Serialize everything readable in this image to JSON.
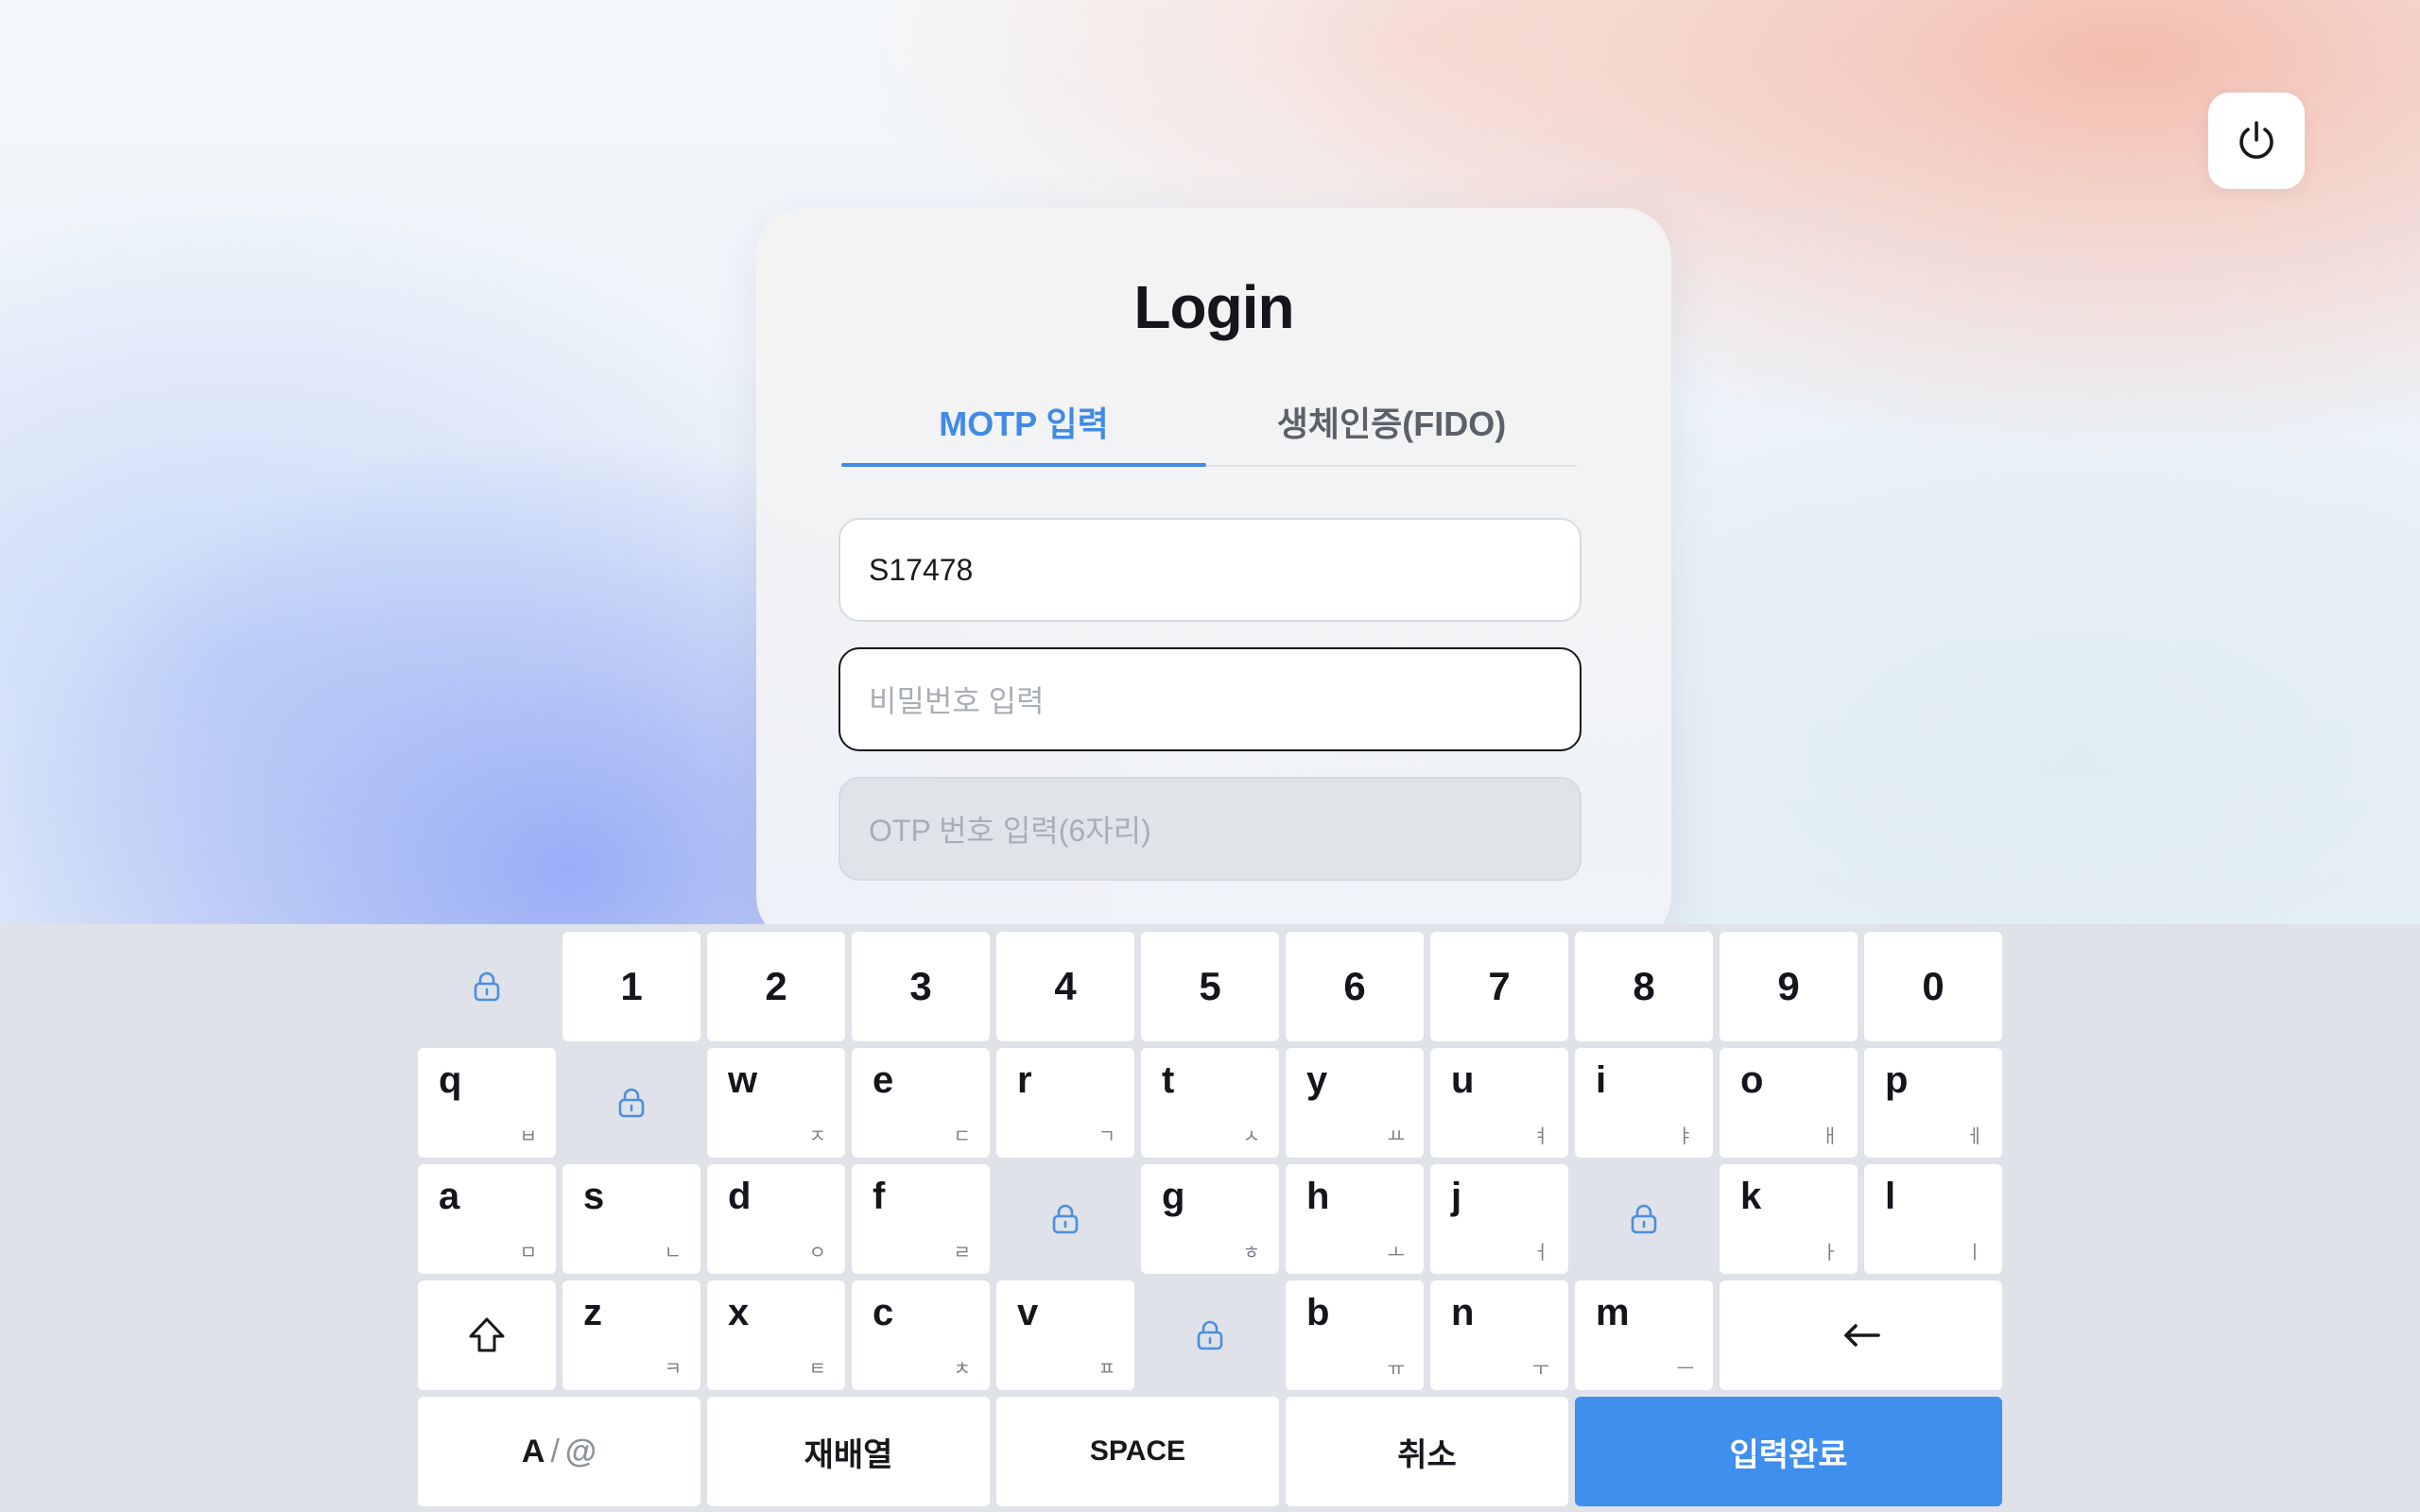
{
  "login": {
    "title": "Login",
    "tabs": [
      {
        "label": "MOTP 입력",
        "active": true
      },
      {
        "label": "생체인증(FIDO)",
        "active": false
      }
    ],
    "fields": {
      "user_id": {
        "value": "S17478"
      },
      "password": {
        "placeholder": "비밀번호 입력",
        "value": ""
      },
      "otp": {
        "placeholder": "OTP 번호 입력(6자리)",
        "value": "",
        "disabled": true
      }
    }
  },
  "power_button": {
    "icon": "power-icon"
  },
  "keyboard": {
    "row1": [
      "1",
      "2",
      "3",
      "4",
      "5",
      "6",
      "7",
      "8",
      "9",
      "0"
    ],
    "row2": [
      {
        "key": "q",
        "sub": "ㅂ"
      },
      {
        "key": "w",
        "sub": "ㅈ"
      },
      {
        "key": "e",
        "sub": "ㄷ"
      },
      {
        "key": "r",
        "sub": "ㄱ"
      },
      {
        "key": "t",
        "sub": "ㅅ"
      },
      {
        "key": "y",
        "sub": "ㅛ"
      },
      {
        "key": "u",
        "sub": "ㅕ"
      },
      {
        "key": "i",
        "sub": "ㅑ"
      },
      {
        "key": "o",
        "sub": "ㅐ"
      },
      {
        "key": "p",
        "sub": "ㅔ"
      }
    ],
    "row3": [
      {
        "key": "a",
        "sub": "ㅁ"
      },
      {
        "key": "s",
        "sub": "ㄴ"
      },
      {
        "key": "d",
        "sub": "ㅇ"
      },
      {
        "key": "f",
        "sub": "ㄹ"
      },
      {
        "key": "g",
        "sub": "ㅎ"
      },
      {
        "key": "h",
        "sub": "ㅗ"
      },
      {
        "key": "j",
        "sub": "ㅓ"
      },
      {
        "key": "k",
        "sub": "ㅏ"
      },
      {
        "key": "l",
        "sub": "ㅣ"
      }
    ],
    "row4": [
      {
        "key": "z",
        "sub": "ㅋ"
      },
      {
        "key": "x",
        "sub": "ㅌ"
      },
      {
        "key": "c",
        "sub": "ㅊ"
      },
      {
        "key": "v",
        "sub": "ㅍ"
      },
      {
        "key": "b",
        "sub": "ㅠ"
      },
      {
        "key": "n",
        "sub": "ㅜ"
      },
      {
        "key": "m",
        "sub": "ㅡ"
      }
    ],
    "shift_icon": "shift-icon",
    "backspace_icon": "backspace-arrow-icon",
    "lock_icon": "lock-icon",
    "bottom": {
      "mode_a": "A",
      "mode_slash": "/",
      "mode_at": "@",
      "shuffle": "재배열",
      "space": "SPACE",
      "cancel": "취소",
      "done": "입력완료"
    },
    "colors": {
      "accent": "#3f8fee",
      "lock": "#4a8fe0"
    }
  }
}
